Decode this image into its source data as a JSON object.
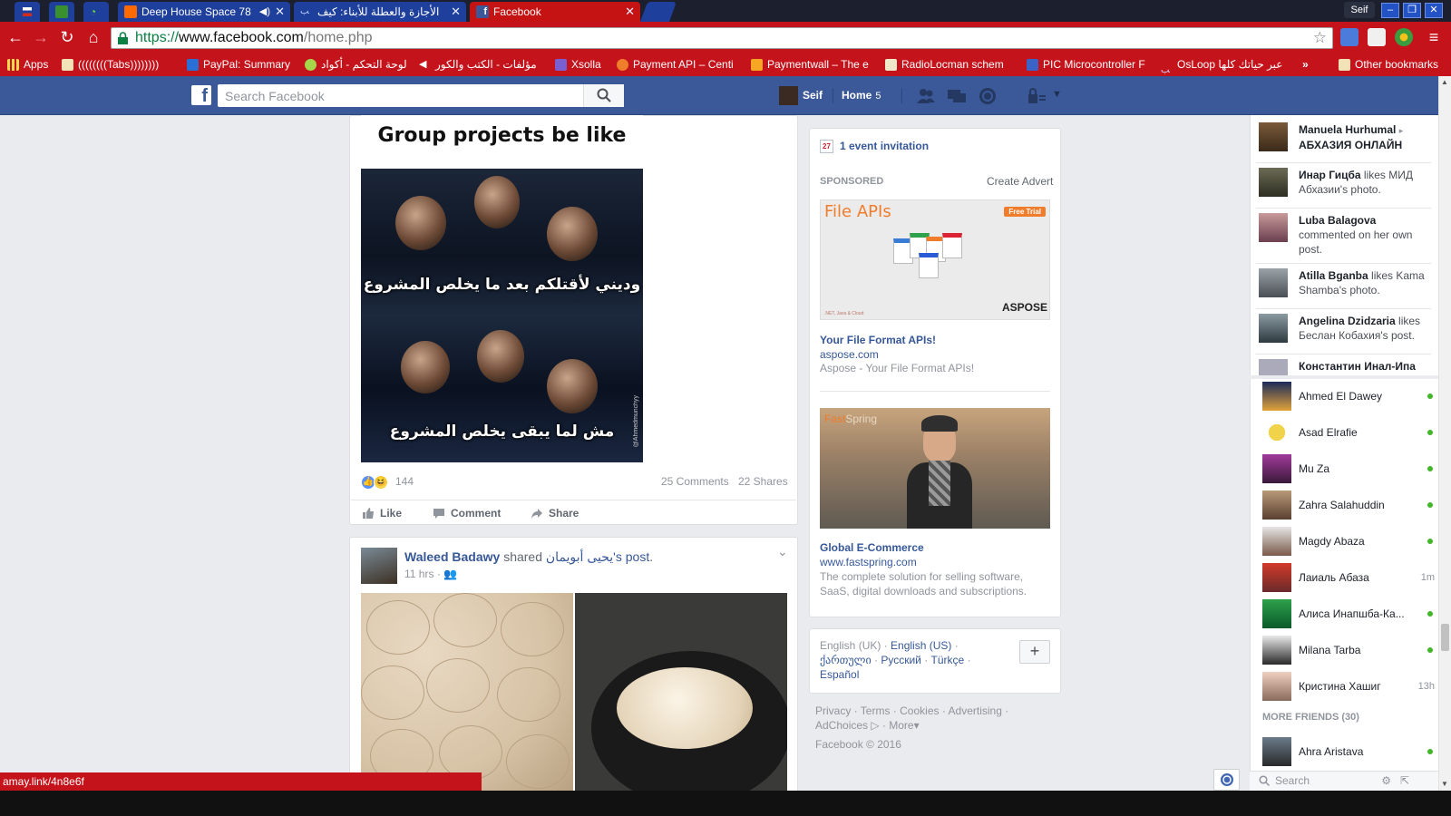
{
  "browser": {
    "tabs": [
      {
        "title": "Deep House Space 78",
        "icon": "soundcloud-icon",
        "color": "#ff6a00"
      },
      {
        "title": "الأجازة والعطلة للأبناء: كيف",
        "icon": "bird-icon",
        "color": "#bcd0ff"
      },
      {
        "title": "Facebook",
        "icon": "facebook-icon",
        "color": "#3b5998"
      }
    ],
    "profile_name": "Seif",
    "url": {
      "scheme": "https://",
      "host": "www.facebook.com",
      "path": "/home.php"
    },
    "bookmarks": [
      {
        "label": "Apps",
        "icon": "apps-grid-icon"
      },
      {
        "label": "((((((((Tabs))))))))",
        "icon": "folder-icon"
      },
      {
        "label": "PayPal: Summary",
        "icon": "paypal-icon"
      },
      {
        "label": "لوحة التحكم - أكواد",
        "icon": "bookmark-icon"
      },
      {
        "label": "مؤلفات - الكتب والكور",
        "icon": "speaker-icon"
      },
      {
        "label": "Xsolla",
        "icon": "xsolla-icon"
      },
      {
        "label": "Payment API – Centi",
        "icon": "payment-icon"
      },
      {
        "label": "Paymentwall – The e",
        "icon": "paymentwall-icon"
      },
      {
        "label": "RadioLocman schem",
        "icon": "radiolocman-icon"
      },
      {
        "label": "PIC Microcontroller F",
        "icon": "pic-icon"
      },
      {
        "label": "OsLoop عبر حياتك كلها",
        "icon": "osloop-icon"
      },
      {
        "label": "»",
        "icon": "overflow-icon"
      },
      {
        "label": "Other bookmarks",
        "icon": "folder-icon"
      }
    ],
    "status_url": "amay.link/4n8e6f"
  },
  "fbbar": {
    "search_placeholder": "Search Facebook",
    "user_name": "Seif",
    "home_label": "Home",
    "home_count": "5"
  },
  "post1": {
    "caption": "Group projects be like",
    "arabic_top": "وديني لأقتلكم بعد ما يخلص المشروع",
    "arabic_bottom": "مش لما يبقى يخلص المشروع",
    "watermark": "@Ahmedmunchyy",
    "reaction_count": "144",
    "comments": "25 Comments",
    "shares": "22 Shares",
    "actions": {
      "like": "Like",
      "comment": "Comment",
      "share": "Share"
    }
  },
  "post2": {
    "author": "Waleed Badawy",
    "shared": "shared",
    "source": "يحيى أبويمان",
    "poss": "'s",
    "post_word": "post",
    "period": ".",
    "time": "11 hrs",
    "sep": "·"
  },
  "rightcol": {
    "event_invite": "1 event invitation",
    "cal_num": "27",
    "sponsored": "SPONSORED",
    "create_advert": "Create Advert",
    "ad1": {
      "img_title": "File APIs",
      "img_badge": "Free Trial",
      "img_brand": "ASPOSE",
      "img_sub": ".NET, Java & Cloud",
      "title": "Your File Format APIs!",
      "url": "aspose.com",
      "desc": "Aspose - Your File Format APIs!"
    },
    "ad2": {
      "img_brand_a": "Fast",
      "img_brand_b": "Spring",
      "title": "Global E-Commerce",
      "url": "www.fastspring.com",
      "desc": "The complete solution for selling software, SaaS, digital downloads and subscriptions."
    },
    "languages": {
      "current": "English (UK)",
      "others": [
        "English (US)",
        "ქართული",
        "Русский",
        "Türkçe",
        "Español"
      ]
    },
    "plus": "+",
    "footer": {
      "links": [
        "Privacy",
        "Terms",
        "Cookies",
        "Advertising",
        "AdChoices",
        "More"
      ],
      "copyright": "Facebook © 2016"
    }
  },
  "ticker": [
    {
      "name": "Manuela Hurhumal",
      "text": "АБХАЗИЯ ОНЛАЙН",
      "arrow": "▸"
    },
    {
      "name": "Инар Гицба",
      "text": "likes МИД Абхазии's photo."
    },
    {
      "name": "Luba Balagova",
      "text": "commented on her own post."
    },
    {
      "name": "Atilla Bganba",
      "text": "likes Kama Shamba's photo."
    },
    {
      "name": "Angelina Dzidzaria",
      "text": "likes Беслан Кобахия's post."
    },
    {
      "name": "Константин Инал-Ипа",
      "text": ""
    }
  ],
  "friends": [
    {
      "name": "Ahmed El Dawey",
      "status": "online"
    },
    {
      "name": "Asad Elrafie",
      "status": "online"
    },
    {
      "name": "Mu Za",
      "status": "online"
    },
    {
      "name": "Zahra Salahuddin",
      "status": "online"
    },
    {
      "name": "Magdy Abaza",
      "status": "online"
    },
    {
      "name": "Лаиаль Абаза",
      "status": "1m"
    },
    {
      "name": "Алиса Инапшба-Ка...",
      "status": "online"
    },
    {
      "name": "Milana Tarba",
      "status": "online"
    },
    {
      "name": "Кристина Хашиг",
      "status": "13h"
    }
  ],
  "more_friends": "MORE FRIENDS (30)",
  "more_friend_list": [
    {
      "name": "Ahra Aristava",
      "status": "online"
    }
  ],
  "chat_search": "Search"
}
